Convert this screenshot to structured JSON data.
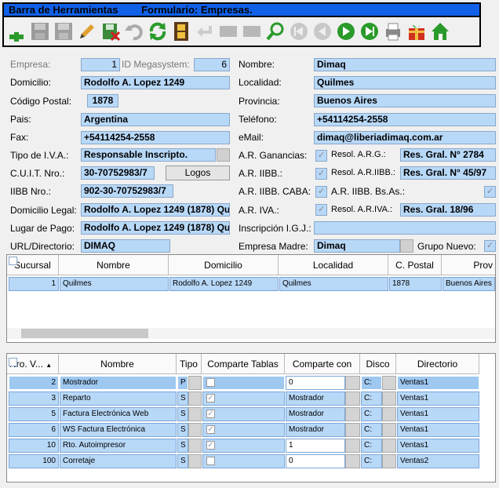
{
  "window": {
    "toolbar_title": "Barra de Herramientas",
    "form_title": "Formulario: Empresas."
  },
  "toolbar": {
    "buttons": [
      "add-icon",
      "save-icon",
      "save-as-icon",
      "edit-icon",
      "delete-icon",
      "undo-icon",
      "refresh-icon",
      "film-icon",
      "back-icon",
      "blank-icon",
      "blank-icon",
      "search-icon",
      "first-icon",
      "prev-icon",
      "next-icon",
      "last-icon",
      "print-icon",
      "gift-icon",
      "home-icon"
    ]
  },
  "form": {
    "empresa_label": "Empresa:",
    "empresa_value": "1",
    "id_mega_label": "ID Megasystem:",
    "id_mega_value": "6",
    "nombre_label": "Nombre:",
    "nombre_value": "Dimaq",
    "domicilio_label": "Domicilio:",
    "domicilio_value": "Rodolfo A. Lopez 1249",
    "localidad_label": "Localidad:",
    "localidad_value": "Quilmes",
    "cp_label": "Código Postal:",
    "cp_value": "1878",
    "provincia_label": "Provincia:",
    "provincia_value": "Buenos Aires",
    "pais_label": "Pais:",
    "pais_value": "Argentina",
    "telefono_label": "Teléfono:",
    "telefono_value": "+54114254-2558",
    "fax_label": "Fax:",
    "fax_value": "+54114254-2558",
    "email_label": "eMail:",
    "email_value": "dimaq@liberiadimaq.com.ar",
    "iva_label": "Tipo de I.V.A.:",
    "iva_value": "Responsable Inscripto.",
    "ar_ganancias_label": "A.R. Ganancias:",
    "resol_arg_label": "Resol. A.R.G.:",
    "resol_arg_value": "Res. Gral. N° 2784",
    "cuit_label": "C.U.I.T. Nro.:",
    "cuit_value": "30-70752983/7",
    "logos_button": "Logos",
    "ar_iibb_label": "A.R. IIBB.:",
    "resol_ariibb_label": "Resol. A.R.IIBB.:",
    "resol_ariibb_value": "Res. Gral. N° 45/97",
    "iibb_label": "IIBB Nro.:",
    "iibb_value": "902-30-70752983/7",
    "ar_iibb_caba_label": "A.R. IIBB. CABA:",
    "ar_iibb_bsas_label": "A.R. IIBB. Bs.As.:",
    "dom_legal_label": "Domicilio Legal:",
    "dom_legal_value": "Rodolfo A. Lopez 1249 (1878) Qu",
    "ar_iva_label": "A.R. IVA.:",
    "resol_ariva_label": "Resol. A.R.IVA.:",
    "resol_ariva_value": "Res. Gral. 18/96",
    "lugar_pago_label": "Lugar de Pago:",
    "lugar_pago_value": "Rodolfo A. Lopez 1249 (1878) Qu",
    "igj_label": "Inscripción I.G.J.:",
    "igj_value": "",
    "url_label": "URL/Directorio:",
    "url_value": "DIMAQ",
    "empresa_madre_label": "Empresa Madre:",
    "empresa_madre_value": "Dimaq",
    "grupo_nuevo_label": "Grupo Nuevo:"
  },
  "sucursales": {
    "headers": [
      "Sucursal",
      "Nombre",
      "Domicilio",
      "Localidad",
      "C. Postal",
      "Prov"
    ],
    "rows": [
      [
        "1",
        "Quilmes",
        "Rodolfo A. Lopez 1249",
        "Quilmes",
        "1878",
        "Buenos Aires"
      ]
    ]
  },
  "puntos": {
    "headers": [
      "Nro. V...",
      "Nombre",
      "Tipo",
      "Comparte Tablas",
      "Comparte con",
      "Disco",
      "Directorio"
    ],
    "rows": [
      {
        "nro": "2",
        "nombre": "Mostrador",
        "tipo": "P",
        "comparte_tablas": false,
        "comparte_con": "0",
        "disco": "C:",
        "directorio": "Ventas1"
      },
      {
        "nro": "3",
        "nombre": "Reparto",
        "tipo": "S",
        "comparte_tablas": true,
        "comparte_con": "Mostrador",
        "disco": "C:",
        "directorio": "Ventas1"
      },
      {
        "nro": "5",
        "nombre": "Factura Electrónica Web",
        "tipo": "S",
        "comparte_tablas": true,
        "comparte_con": "Mostrador",
        "disco": "C:",
        "directorio": "Ventas1"
      },
      {
        "nro": "6",
        "nombre": "WS Factura Electrónica",
        "tipo": "S",
        "comparte_tablas": true,
        "comparte_con": "Mostrador",
        "disco": "C:",
        "directorio": "Ventas1"
      },
      {
        "nro": "10",
        "nombre": "Rto. Autoimpresor",
        "tipo": "S",
        "comparte_tablas": true,
        "comparte_con": "1",
        "disco": "C:",
        "directorio": "Ventas1"
      },
      {
        "nro": "100",
        "nombre": "Corretaje",
        "tipo": "S",
        "comparte_tablas": false,
        "comparte_con": "0",
        "disco": "C:",
        "directorio": "Ventas2"
      }
    ]
  }
}
